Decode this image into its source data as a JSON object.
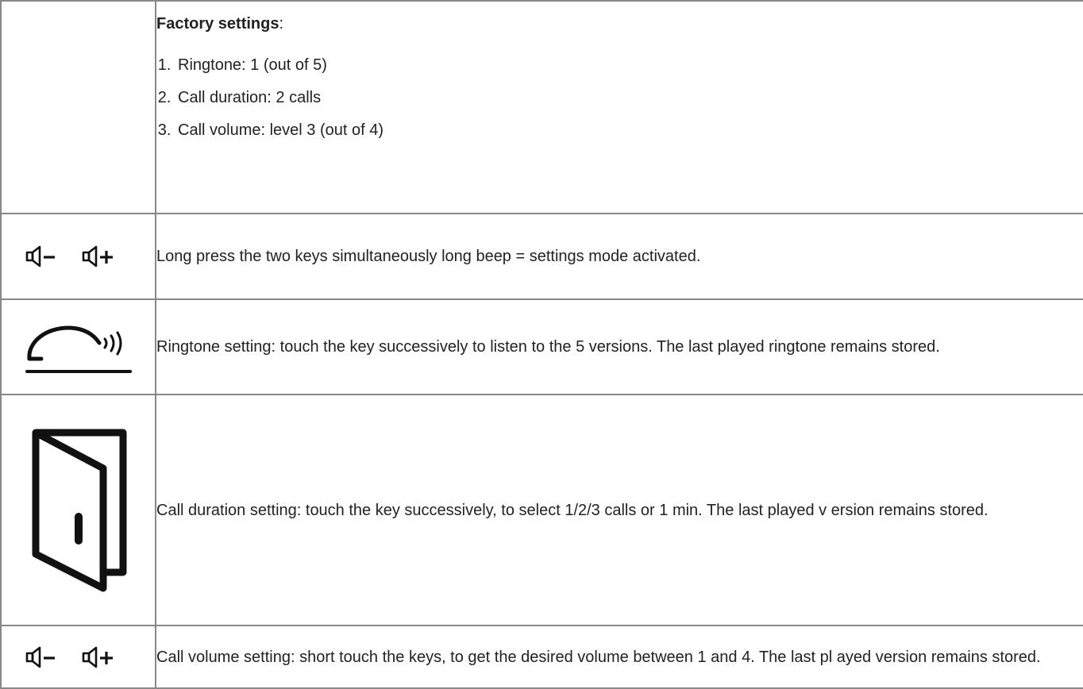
{
  "factory": {
    "title": "Factory settings",
    "colon": ":",
    "items": [
      "Ringtone: 1 (out of 5)",
      "Call duration: 2 calls",
      "Call volume: level 3 (out of 4)"
    ]
  },
  "rows": [
    {
      "icon": "volume-keys-icon",
      "text": "Long press the two keys simultaneously long beep = settings mode activated."
    },
    {
      "icon": "bell-ringtone-icon",
      "text": "Ringtone setting: touch the key successively to listen to the 5 versions. The last played ringtone remains stored."
    },
    {
      "icon": "door-icon",
      "text": "Call duration setting: touch the key successively, to select 1/2/3 calls or 1 min. The last played v ersion remains stored."
    },
    {
      "icon": "volume-keys-icon",
      "text": "Call volume setting: short touch the keys, to get the desired volume between 1 and 4. The last pl ayed version remains stored."
    }
  ]
}
